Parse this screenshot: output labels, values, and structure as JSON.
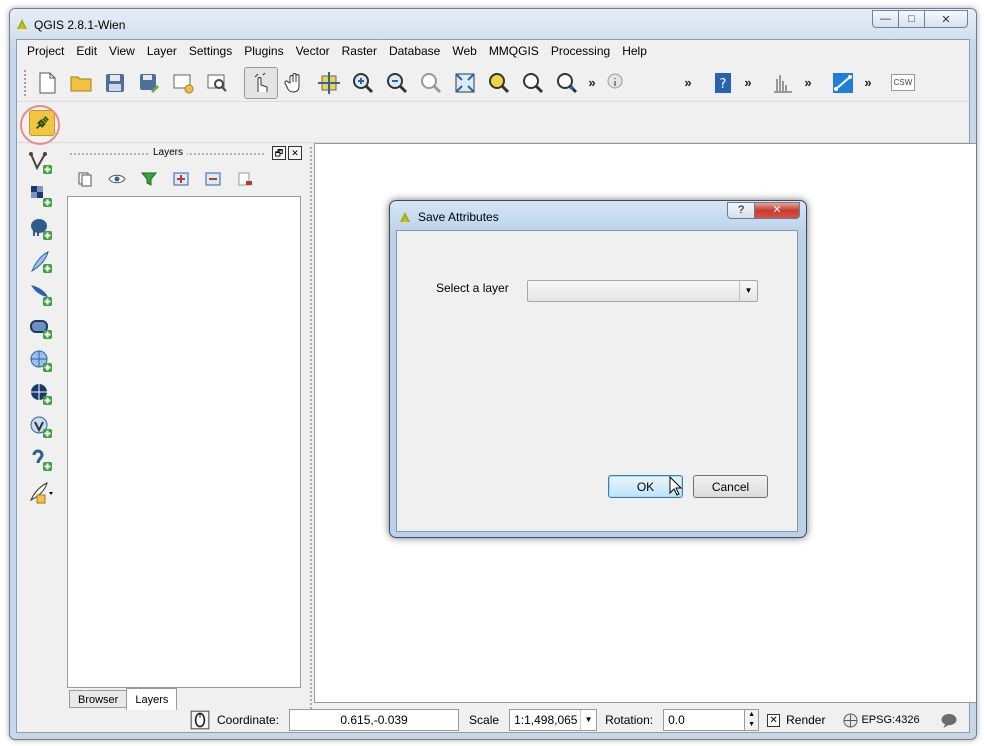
{
  "window": {
    "title": "QGIS 2.8.1-Wien",
    "controls": [
      "—",
      "□",
      "✕"
    ]
  },
  "menubar": {
    "items": [
      "Project",
      "Edit",
      "View",
      "Layer",
      "Settings",
      "Plugins",
      "Vector",
      "Raster",
      "Database",
      "Web",
      "MMQGIS",
      "Processing",
      "Help"
    ]
  },
  "toolbar": {
    "csw_label": "CSW",
    "help_label": "?",
    "more": "»"
  },
  "layers_panel": {
    "title": "Layers",
    "float_btn": "🗗",
    "close_btn": "✕",
    "tabs": [
      "Browser",
      "Layers"
    ],
    "selected_tab": "Layers"
  },
  "dialog": {
    "title": "Save Attributes",
    "help_btn": "?",
    "close_btn": "✕",
    "select_label": "Select a layer",
    "combo_value": "",
    "ok_label": "OK",
    "cancel_label": "Cancel"
  },
  "statusbar": {
    "coordinate_label": "Coordinate:",
    "coordinate_value": "0.615,-0.039",
    "scale_label": "Scale",
    "scale_value": "1:1,498,065",
    "rotation_label": "Rotation:",
    "rotation_value": "0.0",
    "render_label": "Render",
    "render_checked": true,
    "crs_label": "EPSG:4326"
  },
  "colors": {
    "accent": "#3c7fb1",
    "highlight_ring": "#e88a8a",
    "plugin": "#f4c542"
  }
}
